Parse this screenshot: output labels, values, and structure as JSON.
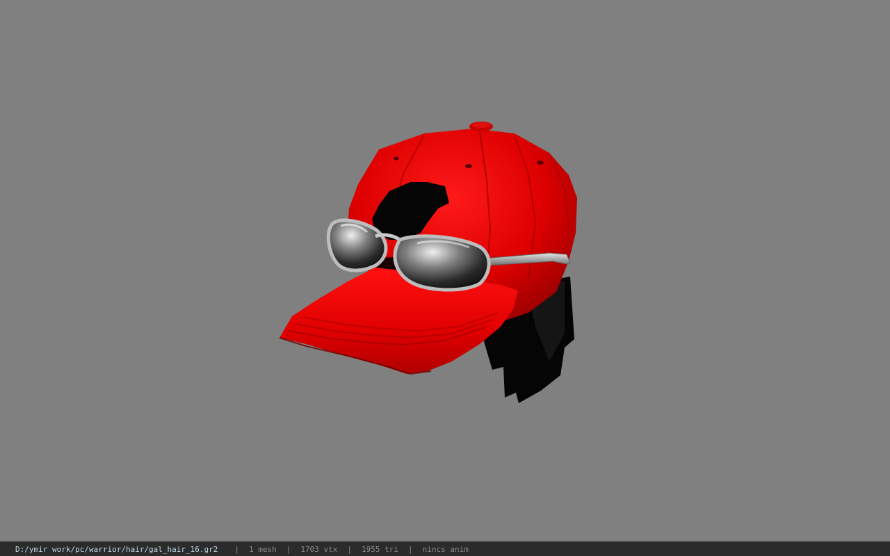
{
  "viewport": {
    "background": "#808080",
    "model_name": "baseball cap with sunglasses and hair"
  },
  "status": {
    "path": "D:/ymir work/pc/warrior/hair/gal_hair_16.gr2",
    "separator": "|",
    "mesh": "1 mesh",
    "vtx": "1703 vtx",
    "tri": "1955 tri",
    "anim": "nincs anim"
  },
  "colors": {
    "cap_red": "#e00000",
    "hair": "#050505",
    "lens": "#3a3a3a",
    "frame": "#bdbdbd"
  }
}
